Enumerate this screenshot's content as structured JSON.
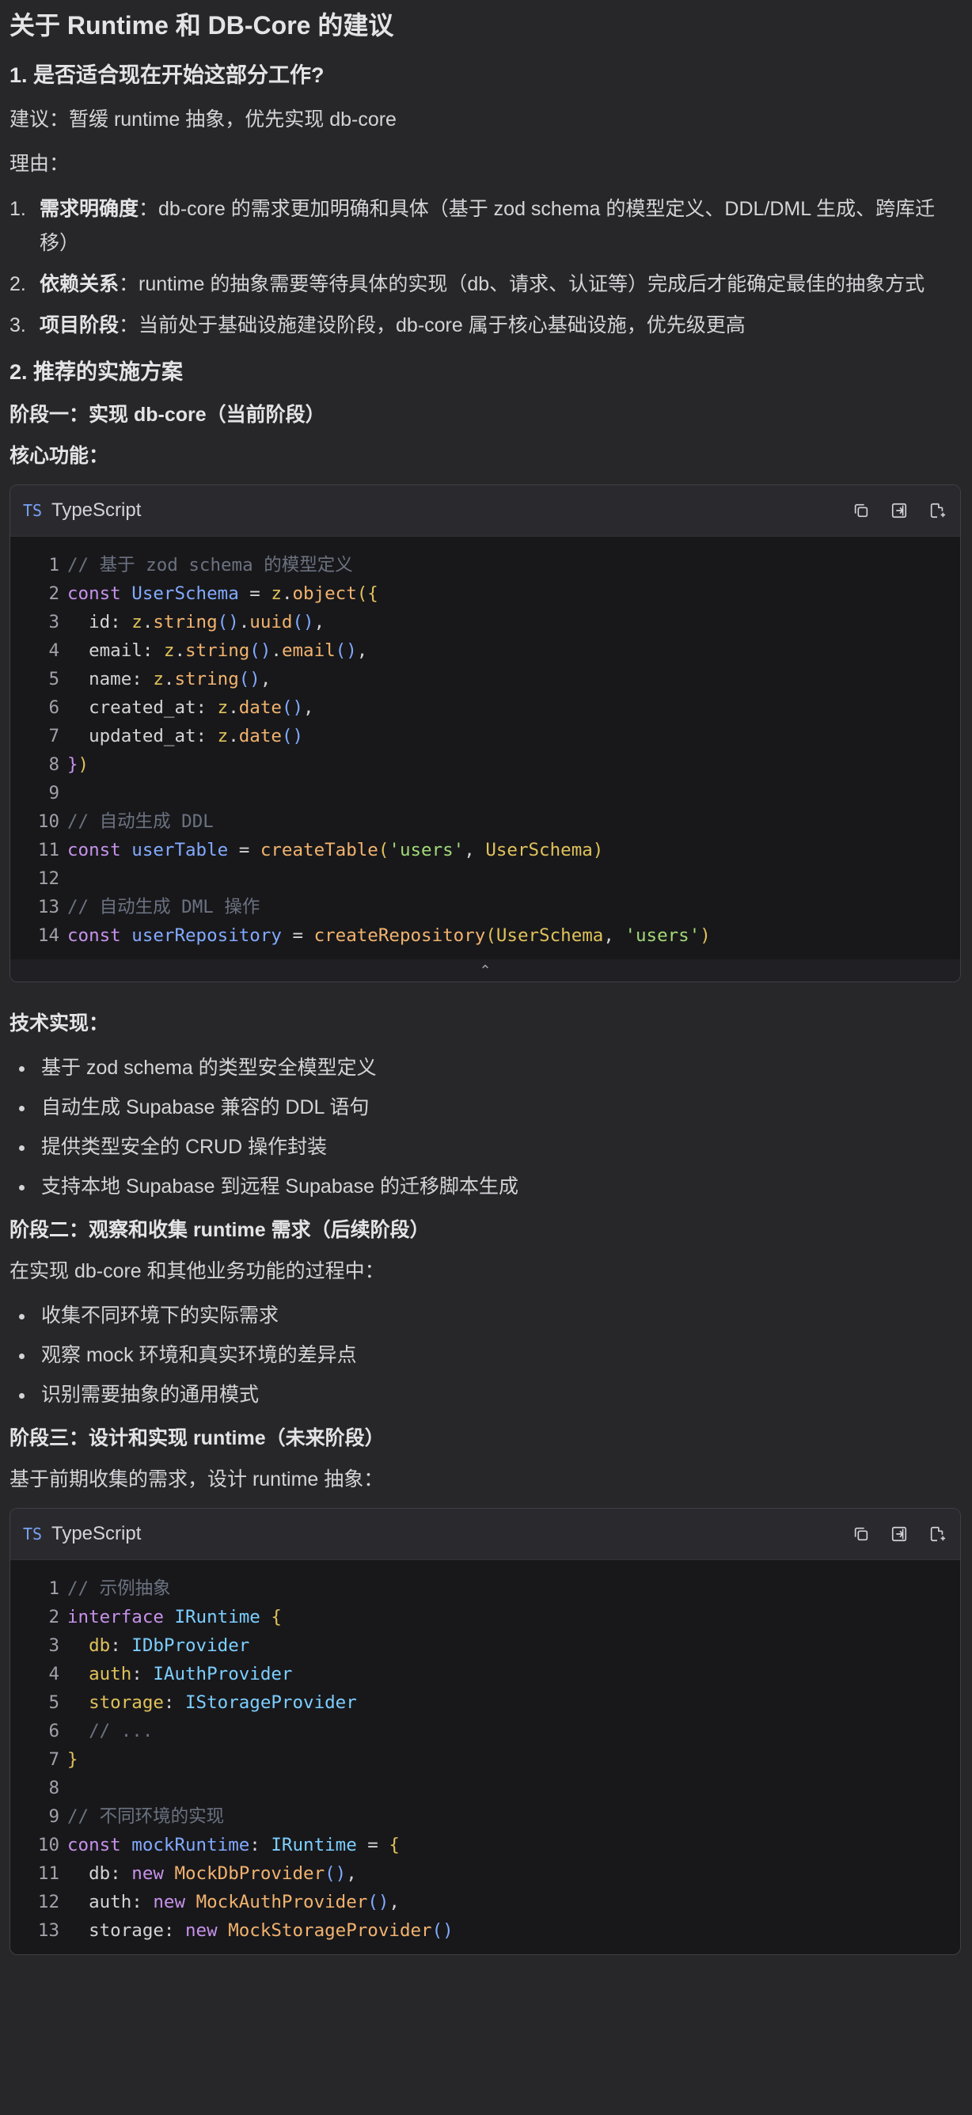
{
  "title": "关于 Runtime 和 DB-Core 的建议",
  "section1": {
    "heading": "1. 是否适合现在开始这部分工作?",
    "suggestion": "建议：暂缓 runtime 抽象，优先实现 db-core",
    "reasons_label": "理由：",
    "reasons": [
      {
        "num": "1.",
        "title": "需求明确度",
        "text": "：db-core 的需求更加明确和具体（基于 zod schema 的模型定义、DDL/DML 生成、跨库迁移）"
      },
      {
        "num": "2.",
        "title": "依赖关系",
        "text": "：runtime 的抽象需要等待具体的实现（db、请求、认证等）完成后才能确定最佳的抽象方式"
      },
      {
        "num": "3.",
        "title": "项目阶段",
        "text": "：当前处于基础设施建设阶段，db-core 属于核心基础设施，优先级更高"
      }
    ]
  },
  "section2": {
    "heading": "2. 推荐的实施方案",
    "phase1": {
      "heading": "阶段一：实现 db-core（当前阶段）",
      "core_label": "核心功能：",
      "tech_label": "技术实现：",
      "tech_items": [
        "基于 zod schema 的类型安全模型定义",
        "自动生成 Supabase 兼容的 DDL 语句",
        "提供类型安全的 CRUD 操作封装",
        "支持本地 Supabase 到远程 Supabase 的迁移脚本生成"
      ]
    },
    "phase2": {
      "heading": "阶段二：观察和收集 runtime 需求（后续阶段）",
      "intro": "在实现 db-core 和其他业务功能的过程中：",
      "items": [
        "收集不同环境下的实际需求",
        "观察 mock 环境和真实环境的差异点",
        "识别需要抽象的通用模式"
      ]
    },
    "phase3": {
      "heading": "阶段三：设计和实现 runtime（未来阶段）",
      "intro": "基于前期收集的需求，设计 runtime 抽象："
    }
  },
  "code_blocks": [
    {
      "lang_icon": "TS",
      "lang": "TypeScript",
      "collapse": "⌃",
      "lines": [
        [
          [
            "c-cm",
            "// 基于 zod schema 的模型定义"
          ]
        ],
        [
          [
            "c-kw",
            "const "
          ],
          [
            "c-id",
            "UserSchema"
          ],
          [
            "c-pn",
            " = "
          ],
          [
            "c-z",
            "z"
          ],
          [
            "c-pn",
            "."
          ],
          [
            "c-fn",
            "object"
          ],
          [
            "c-br",
            "({"
          ]
        ],
        [
          [
            "c-pn",
            "  id: "
          ],
          [
            "c-z",
            "z"
          ],
          [
            "c-pn",
            "."
          ],
          [
            "c-fn",
            "string"
          ],
          [
            "c-id",
            "()"
          ],
          [
            "c-pn",
            "."
          ],
          [
            "c-fn",
            "uuid"
          ],
          [
            "c-id",
            "()"
          ],
          [
            "c-pn",
            ","
          ]
        ],
        [
          [
            "c-pn",
            "  email: "
          ],
          [
            "c-z",
            "z"
          ],
          [
            "c-pn",
            "."
          ],
          [
            "c-fn",
            "string"
          ],
          [
            "c-id",
            "()"
          ],
          [
            "c-pn",
            "."
          ],
          [
            "c-fn",
            "email"
          ],
          [
            "c-id",
            "()"
          ],
          [
            "c-pn",
            ","
          ]
        ],
        [
          [
            "c-pn",
            "  name: "
          ],
          [
            "c-z",
            "z"
          ],
          [
            "c-pn",
            "."
          ],
          [
            "c-fn",
            "string"
          ],
          [
            "c-id",
            "()"
          ],
          [
            "c-pn",
            ","
          ]
        ],
        [
          [
            "c-pn",
            "  created_at: "
          ],
          [
            "c-z",
            "z"
          ],
          [
            "c-pn",
            "."
          ],
          [
            "c-fn",
            "date"
          ],
          [
            "c-id",
            "()"
          ],
          [
            "c-pn",
            ","
          ]
        ],
        [
          [
            "c-pn",
            "  updated_at: "
          ],
          [
            "c-z",
            "z"
          ],
          [
            "c-pn",
            "."
          ],
          [
            "c-fn",
            "date"
          ],
          [
            "c-id",
            "()"
          ]
        ],
        [
          [
            "c-kw",
            "}"
          ],
          [
            "c-br",
            ")"
          ]
        ],
        [],
        [
          [
            "c-cm",
            "// 自动生成 DDL"
          ]
        ],
        [
          [
            "c-kw",
            "const "
          ],
          [
            "c-id",
            "userTable"
          ],
          [
            "c-pn",
            " = "
          ],
          [
            "c-fn",
            "createTable"
          ],
          [
            "c-br",
            "("
          ],
          [
            "c-str",
            "'users'"
          ],
          [
            "c-pn",
            ", "
          ],
          [
            "c-cls",
            "UserSchema"
          ],
          [
            "c-br",
            ")"
          ]
        ],
        [],
        [
          [
            "c-cm",
            "// 自动生成 DML 操作"
          ]
        ],
        [
          [
            "c-kw",
            "const "
          ],
          [
            "c-id",
            "userRepository"
          ],
          [
            "c-pn",
            " = "
          ],
          [
            "c-fn",
            "createRepository"
          ],
          [
            "c-br",
            "("
          ],
          [
            "c-cls",
            "UserSchema"
          ],
          [
            "c-pn",
            ", "
          ],
          [
            "c-str",
            "'users'"
          ],
          [
            "c-br",
            ")"
          ]
        ]
      ]
    },
    {
      "lang_icon": "TS",
      "lang": "TypeScript",
      "collapse": "",
      "lines": [
        [
          [
            "c-cm",
            "// 示例抽象"
          ]
        ],
        [
          [
            "c-kw",
            "interface "
          ],
          [
            "c-ty",
            "IRuntime"
          ],
          [
            "c-br",
            " {"
          ]
        ],
        [
          [
            "c-pn",
            "  "
          ],
          [
            "c-cls",
            "db"
          ],
          [
            "c-pn",
            ": "
          ],
          [
            "c-ty",
            "IDbProvider"
          ]
        ],
        [
          [
            "c-pn",
            "  "
          ],
          [
            "c-cls",
            "auth"
          ],
          [
            "c-pn",
            ": "
          ],
          [
            "c-ty",
            "IAuthProvider"
          ]
        ],
        [
          [
            "c-pn",
            "  "
          ],
          [
            "c-cls",
            "storage"
          ],
          [
            "c-pn",
            ": "
          ],
          [
            "c-ty",
            "IStorageProvider"
          ]
        ],
        [
          [
            "c-cm",
            "  // ..."
          ]
        ],
        [
          [
            "c-br",
            "}"
          ]
        ],
        [],
        [
          [
            "c-cm",
            "// 不同环境的实现"
          ]
        ],
        [
          [
            "c-kw",
            "const "
          ],
          [
            "c-id",
            "mockRuntime"
          ],
          [
            "c-pn",
            ": "
          ],
          [
            "c-ty",
            "IRuntime"
          ],
          [
            "c-pn",
            " = "
          ],
          [
            "c-br",
            "{"
          ]
        ],
        [
          [
            "c-pn",
            "  db: "
          ],
          [
            "c-new",
            "new "
          ],
          [
            "c-ctor",
            "MockDbProvider"
          ],
          [
            "c-id",
            "()"
          ],
          [
            "c-pn",
            ","
          ]
        ],
        [
          [
            "c-pn",
            "  auth: "
          ],
          [
            "c-new",
            "new "
          ],
          [
            "c-ctor",
            "MockAuthProvider"
          ],
          [
            "c-id",
            "()"
          ],
          [
            "c-pn",
            ","
          ]
        ],
        [
          [
            "c-pn",
            "  storage: "
          ],
          [
            "c-new",
            "new "
          ],
          [
            "c-ctor",
            "MockStorageProvider"
          ],
          [
            "c-id",
            "()"
          ]
        ]
      ]
    }
  ]
}
